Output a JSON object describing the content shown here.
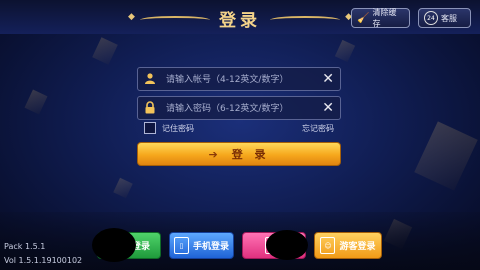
{
  "header": {
    "title": "登录",
    "clear_cache_label": "清除缓存",
    "service_label": "客服",
    "service_icon_text": "24"
  },
  "form": {
    "account_placeholder": "请输入帐号（4-12英文/数字）",
    "password_placeholder": "请输入密码（6-12英文/数字）",
    "remember_label": "记住密码",
    "forgot_label": "忘记密码",
    "login_label": "登 录"
  },
  "bottom": {
    "pack": "Pack 1.5.1",
    "vol": "Vol 1.5.1.19100102",
    "buttons": [
      {
        "label": "登录"
      },
      {
        "label": "手机登录"
      },
      {
        "label": ""
      },
      {
        "label": "游客登录"
      }
    ]
  },
  "colors": {
    "accent_gold": "#f3d38a",
    "login_orange": "#f6a71c",
    "wechat_green": "#2fb24c",
    "phone_blue": "#2f7ae8",
    "pink": "#f04a94"
  },
  "icons": [
    "broom-icon",
    "customer-service-icon",
    "user-icon",
    "lock-icon",
    "clear-x-icon",
    "login-arrow-icon",
    "phone-icon",
    "edit-icon",
    "guest-icon"
  ]
}
